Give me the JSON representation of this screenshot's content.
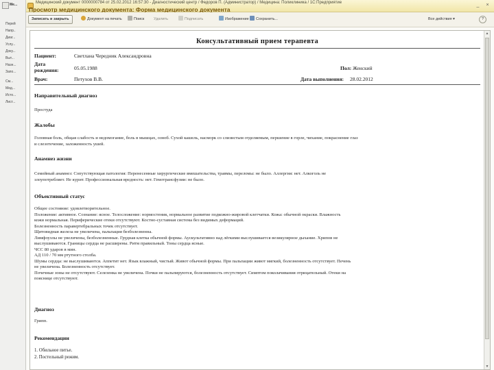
{
  "left_panel": {
    "items": [
      "Ме...",
      "Перей",
      "Напр..",
      "Диаг...",
      "Услу...",
      "Доку...",
      "Выт...",
      "Назн...",
      "Запо...",
      "См...",
      "Мед...",
      "Исто...",
      "Лист..."
    ]
  },
  "window": {
    "title": "Медицинский документ 0000000784 от 25.02.2012 16:57:30 - Диагностический центр / Федоров П. (Администратор) / Медицина: Поликлиника / 1С:Предприятие",
    "heading": "Просмотр медицинского документа: Форма медицинского документа"
  },
  "toolbar": {
    "save_close": "Записать и закрыть",
    "print_view": "Документ на печать",
    "find": "Поиск",
    "delete": "Удалить",
    "sign": "Подписать",
    "image": "Изображение",
    "save_as": "Сохранить...",
    "all_actions": "Все действия",
    "help": "?"
  },
  "document": {
    "title": "Консультативный прием терапевта",
    "patient_label": "Пациент:",
    "patient_value": "Светлана Чередник Александровна",
    "birth_label_1": "Дата",
    "birth_label_2": "рождения:",
    "birth_value": "05.05.1988",
    "sex_label": "Пол:",
    "sex_value": "Женский",
    "doctor_label": "Врач:",
    "doctor_value": "Петухов В.В.",
    "date_label": "Дата выполнения:",
    "date_value": "28.02.2012",
    "sections": [
      {
        "heading": "Направительный диагноз",
        "lines": [
          "Простуда"
        ]
      },
      {
        "heading": "Жалобы",
        "lines": [
          "Головная боль, общая слабость и недомогание, боль в мышцах, озноб. Сухой кашель, насморк со слизистым отделяемым, першение в горле, чихание, покраснение глаз",
          "и слезотечение, заложенность ушей."
        ]
      },
      {
        "heading": "Анамнез жизни",
        "lines": [
          "Семейный анамнез: Сопутствующая патология:  Перенесенные хирургические вмешательства, травмы, переломы: не было. Аллергия: нет. Алкоголь не",
          "злоупотребляет. Не курит. Профессиональная вредность: нет. Гемотрансфузии: не было."
        ]
      },
      {
        "heading": "Объективный статус",
        "lines": [
          "Общее состояние: удовлетворительное.",
          "Положение: активное. Сознание: ясное. Телосложение: нормостеник, нормальное развитие подкожно-жировой клетчатки. Кожа: обычной окраски. Влажность",
          "кожи нормальная. Периферические отеки отсутствуют. Костно-суставная система без видимых деформаций.",
          "Болезненность паравертебральных точек отсутствует.",
          "Щитовидная железа не увеличена, пальпация безболезненна.",
          "Лимфоузлы не увеличены, безболезненные. Грудная клетка обычной формы. Аускультативно над лёгкими выслушивается везикулярное дыхание. Хрипов не",
          "выслушиваются. Границы сердца не расширены. Ритм правильный. Тоны сердца ясные.",
          "ЧСС 80 ударов в мин.",
          "АД 110 / 70 мм ртутного столба.",
          "Шумы сердца: не выслушиваются. Аппетит нет. Язык влажный, чистый. Живот обычной формы. При пальпации живот мягкий, болезненность отсутствует. Печень",
          "не увеличена. Болезненность отсутствует.",
          "Почечные зоны не отсутствуют. Селезенка не увеличена. Почки не пальпируются, болезненность отсутствует. Симптом поколачивания отрицательный. Отеки на",
          "пояснице отсутствуют."
        ]
      },
      {
        "heading": "Диагноз",
        "lines": [
          "Грипп."
        ]
      },
      {
        "heading": "Рекомендации",
        "lines": []
      }
    ],
    "recommendations": [
      "1.  Обильное питье.",
      "2.  Постельный режим."
    ]
  },
  "colors": {
    "titlebar": "#f1e6a8",
    "heading_text": "#7a5a10",
    "toolbar_bg": "#f4f2ea"
  }
}
